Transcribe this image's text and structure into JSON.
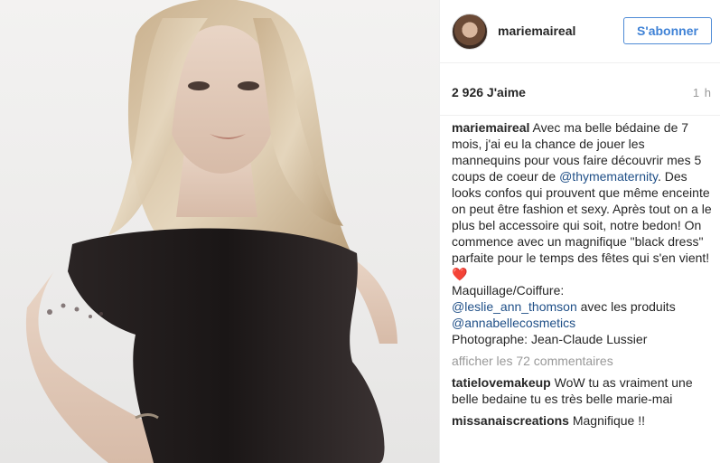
{
  "post": {
    "username": "mariemaireal",
    "follow_label": "S'abonner",
    "likes": "2 926 J'aime",
    "time": "1 h"
  },
  "caption": {
    "author": "mariemaireal",
    "text_1": " Avec ma belle bédaine de 7 mois, j'ai eu la chance de jouer les mannequins pour vous faire découvrir mes 5 coups de coeur de ",
    "mention_1": "@thymematernity",
    "text_2": ". Des looks confos qui prouvent que même enceinte on peut être fashion et sexy. Après tout on a le plus bel accessoire qui soit, notre bedon! On commence avec un magnifique \"black dress\" parfaite pour le temps des fêtes qui s'en vient! ",
    "heart": "❤️",
    "text_3": "Maquillage/Coiffure:",
    "mention_2": "@leslie_ann_thomson",
    "text_4": " avec les produits",
    "mention_3": "@annabellecosmetics",
    "text_5": "Photographe: Jean-Claude Lussier"
  },
  "view_comments": "afficher les 72 commentaires",
  "comments": [
    {
      "user": "tatielovemakeup",
      "text": " WoW tu as vraiment une belle bedaine tu es très belle marie-mai"
    },
    {
      "user": "missanaiscreations",
      "text": " Magnifique !!"
    }
  ],
  "colors": {
    "accent": "#3f82d6",
    "link": "#1f4f87",
    "muted": "#999999",
    "heart": "#e0383e"
  }
}
